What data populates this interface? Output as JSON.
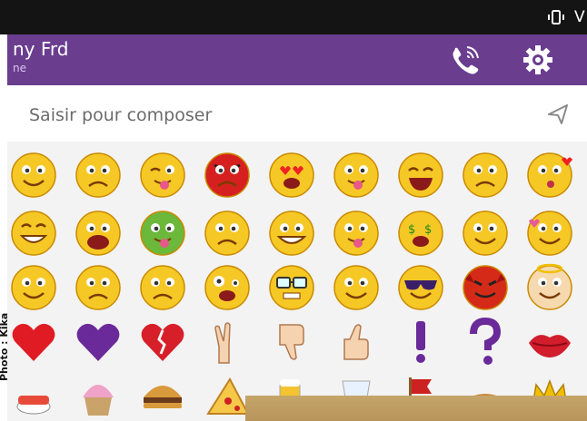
{
  "status_bar": {
    "vibrate_icon": "vibrate-icon",
    "network_glyph": "V"
  },
  "header": {
    "contact_name": "ny Frd",
    "contact_status": "ne",
    "call_icon": "viber-call-icon",
    "settings_icon": "gear-icon",
    "accent_color": "#6a3d8f"
  },
  "composer": {
    "placeholder": "Saisir pour composer",
    "value": "",
    "send_icon": "send-arrow-icon"
  },
  "emoji_grid": {
    "rows": [
      [
        "smile-wide-eyes",
        "pout",
        "wink-tongue",
        "angry-red",
        "heart-eyes",
        "tongue-out",
        "laughing",
        "grimace-shocked",
        "kissing-heart"
      ],
      [
        "grinning",
        "crying-open",
        "sick-green",
        "worried",
        "big-grin-teeth",
        "tongue-out-2",
        "money-eyes",
        "sly",
        "blushing-heart"
      ],
      [
        "nervous",
        "unamused",
        "sad",
        "crazy",
        "nerd-glasses",
        "smirk",
        "sunglasses",
        "devil",
        "angel"
      ],
      [
        "red-heart",
        "purple-heart",
        "broken-heart",
        "victory-hand",
        "thumbs-down",
        "thumbs-up",
        "exclamation",
        "question",
        "lips"
      ],
      [
        "sushi",
        "cupcake",
        "burger",
        "pizza",
        "beer",
        "drink",
        "flag",
        "food",
        "crown"
      ]
    ]
  },
  "photo_credit": "Photo : Kika"
}
